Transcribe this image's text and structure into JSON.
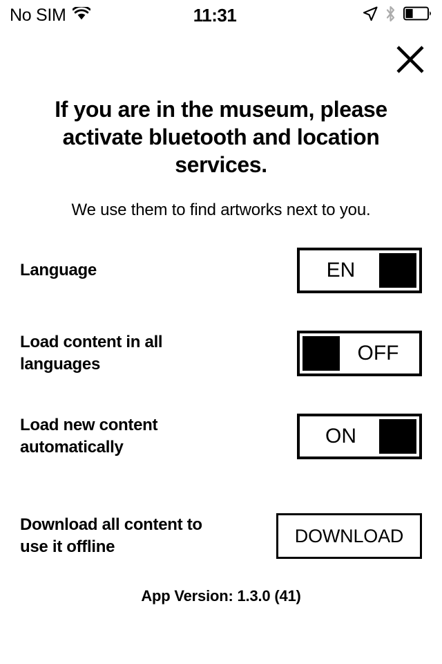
{
  "status_bar": {
    "carrier": "No SIM",
    "wifi_icon": "wifi-icon",
    "time": "11:31",
    "location_icon": "location-arrow-icon",
    "bluetooth_icon": "bluetooth-icon",
    "battery_icon": "battery-icon",
    "battery_level_percent": 30
  },
  "header": {
    "close_icon": "close-icon"
  },
  "main": {
    "headline": "If you are in the museum, please activate bluetooth and location services.",
    "subline": "We use them to find artworks next to you.",
    "rows": [
      {
        "label": "Language",
        "control": "toggle",
        "value": "EN",
        "knob_side": "right"
      },
      {
        "label": "Load content in all\nlanguages",
        "control": "toggle",
        "value": "OFF",
        "knob_side": "left"
      },
      {
        "label": "Load new content\nautomatically",
        "control": "toggle",
        "value": "ON",
        "knob_side": "right"
      },
      {
        "label": "Download all content to\nuse it offline",
        "control": "button",
        "value": "DOWNLOAD"
      }
    ]
  },
  "footer": {
    "version": "App Version: 1.3.0 (41)"
  },
  "colors": {
    "background": "#ffffff",
    "foreground": "#000000",
    "inactive": "#b4b4b4"
  }
}
